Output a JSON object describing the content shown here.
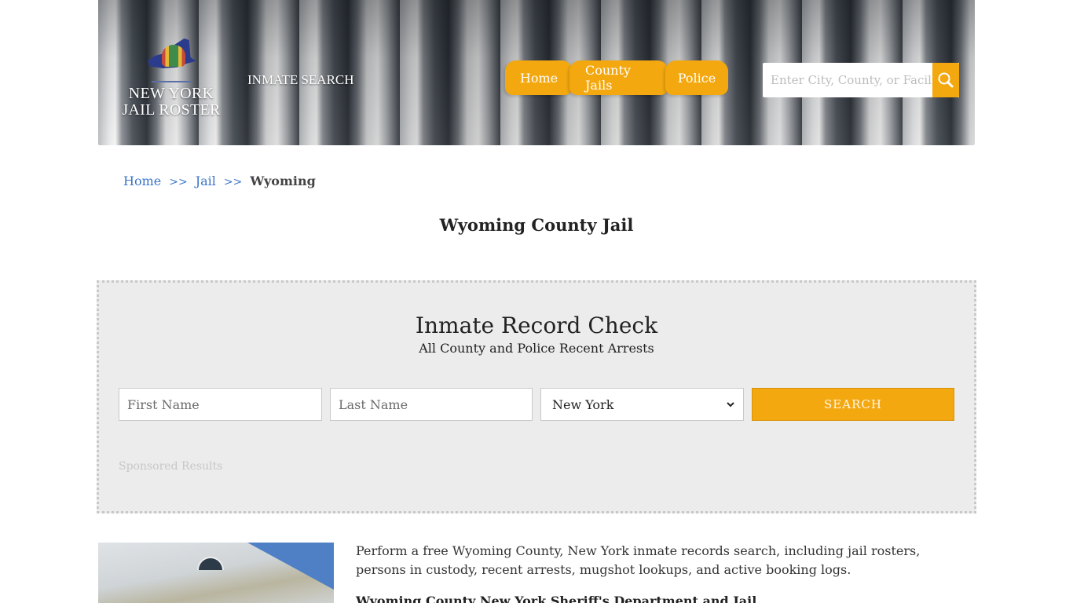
{
  "header": {
    "logo_line1": "NEW YORK",
    "logo_line2": "JAIL ROSTER",
    "inmate_search_link": "INMATE SEARCH",
    "nav": [
      {
        "label": "Home"
      },
      {
        "label": "County Jails"
      },
      {
        "label": "Police"
      }
    ],
    "search": {
      "placeholder": "Enter City, County, or Facility",
      "value": "",
      "icon": "search-icon"
    }
  },
  "breadcrumb": {
    "items": [
      {
        "label": "Home"
      },
      {
        "label": "Jail"
      }
    ],
    "separator": ">>",
    "current": "Wyoming"
  },
  "page_title": "Wyoming County Jail",
  "record_check": {
    "title": "Inmate Record Check",
    "subtitle": "All County and Police Recent Arrests",
    "first_name": {
      "placeholder": "First Name",
      "value": ""
    },
    "last_name": {
      "placeholder": "Last Name",
      "value": ""
    },
    "state_select": {
      "selected": "New York"
    },
    "search_button": "SEARCH",
    "sponsored_label": "Sponsored Results"
  },
  "content": {
    "intro": "Perform a free Wyoming County, New York inmate records search, including jail rosters, persons in custody, recent arrests, mugshot lookups, and active booking logs.",
    "subhead": "Wyoming County New York Sheriff's Department and Jail"
  },
  "colors": {
    "accent": "#f4a80f",
    "link": "#3a74c9",
    "panel_bg": "#ececec"
  }
}
